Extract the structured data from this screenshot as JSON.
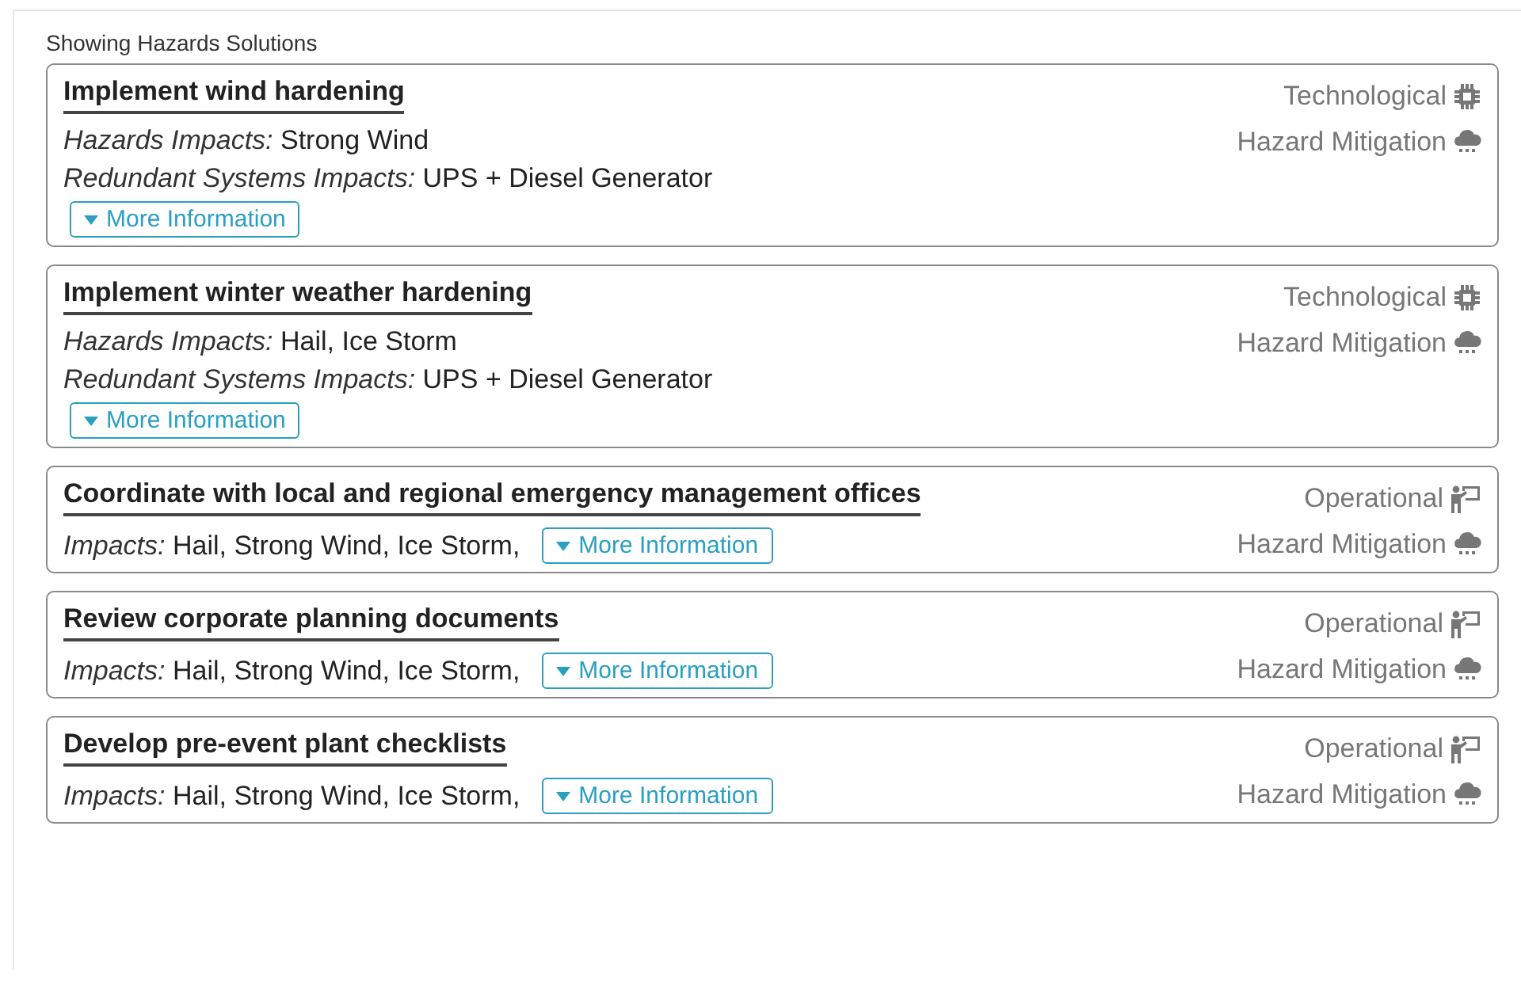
{
  "heading": "Showing Hazards Solutions",
  "solutions": [
    {
      "title": "Implement wind hardening",
      "impacts": [
        {
          "label": "Hazards Impacts:",
          "value": "Strong Wind"
        },
        {
          "label": "Redundant Systems Impacts:",
          "value": "UPS + Diesel Generator"
        }
      ],
      "button": "More Information",
      "tags": [
        {
          "kind": "chip",
          "text": "Technological"
        },
        {
          "kind": "cloud",
          "text": "Hazard Mitigation"
        }
      ]
    },
    {
      "title": "Implement winter weather hardening",
      "impacts": [
        {
          "label": "Hazards Impacts:",
          "value": "Hail, Ice Storm"
        },
        {
          "label": "Redundant Systems Impacts:",
          "value": "UPS + Diesel Generator"
        }
      ],
      "button": "More Information",
      "tags": [
        {
          "kind": "chip",
          "text": "Technological"
        },
        {
          "kind": "cloud",
          "text": "Hazard Mitigation"
        }
      ]
    },
    {
      "title": "Coordinate with local and regional emergency management offices",
      "impacts": [
        {
          "label": "Impacts:",
          "value": "Hail, Strong Wind, Ice Storm,"
        }
      ],
      "button": "More Information",
      "tags": [
        {
          "kind": "presenter",
          "text": "Operational"
        },
        {
          "kind": "cloud",
          "text": "Hazard Mitigation"
        }
      ]
    },
    {
      "title": "Review corporate planning documents",
      "impacts": [
        {
          "label": "Impacts:",
          "value": "Hail, Strong Wind, Ice Storm,"
        }
      ],
      "button": "More Information",
      "tags": [
        {
          "kind": "presenter",
          "text": "Operational"
        },
        {
          "kind": "cloud",
          "text": "Hazard Mitigation"
        }
      ]
    },
    {
      "title": "Develop pre-event plant checklists",
      "impacts": [
        {
          "label": "Impacts:",
          "value": "Hail, Strong Wind, Ice Storm,"
        }
      ],
      "button": "More Information",
      "tags": [
        {
          "kind": "presenter",
          "text": "Operational"
        },
        {
          "kind": "cloud",
          "text": "Hazard Mitigation"
        }
      ]
    }
  ]
}
